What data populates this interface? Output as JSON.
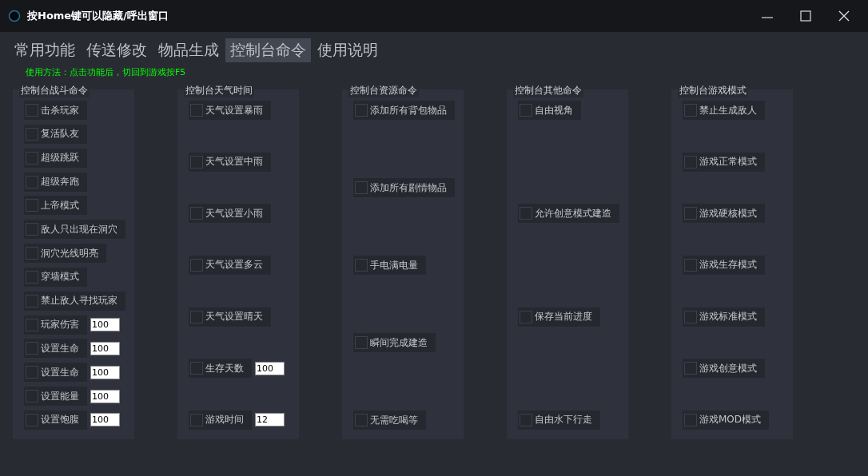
{
  "window": {
    "title": "按Home键可以隐藏/呼出窗口"
  },
  "tabs": [
    {
      "label": "常用功能",
      "selected": false
    },
    {
      "label": "传送修改",
      "selected": false
    },
    {
      "label": "物品生成",
      "selected": false
    },
    {
      "label": "控制台命令",
      "selected": true
    },
    {
      "label": "使用说明",
      "selected": false
    }
  ],
  "hint": "使用方法：点击功能后，切回到游戏按F5",
  "groups": [
    {
      "title": "控制台战斗命令",
      "items": [
        {
          "kind": "toggle",
          "label": "击杀玩家",
          "checked": false
        },
        {
          "kind": "toggle",
          "label": "复活队友",
          "checked": false
        },
        {
          "kind": "toggle",
          "label": "超级跳跃",
          "checked": false
        },
        {
          "kind": "toggle",
          "label": "超级奔跑",
          "checked": false
        },
        {
          "kind": "toggle",
          "label": "上帝模式",
          "checked": false
        },
        {
          "kind": "toggle",
          "label": "敌人只出现在洞穴",
          "checked": false
        },
        {
          "kind": "toggle",
          "label": "洞穴光线明亮",
          "checked": false
        },
        {
          "kind": "toggle",
          "label": "穿墙模式",
          "checked": false
        },
        {
          "kind": "toggle",
          "label": "禁止敌人寻找玩家",
          "checked": false
        },
        {
          "kind": "value",
          "label": "玩家伤害",
          "checked": false,
          "value": "100"
        },
        {
          "kind": "value",
          "label": "设置生命",
          "checked": false,
          "value": "100"
        },
        {
          "kind": "value",
          "label": "设置生命",
          "checked": false,
          "value": "100"
        },
        {
          "kind": "value",
          "label": "设置能量",
          "checked": false,
          "value": "100"
        },
        {
          "kind": "value",
          "label": "设置饱腹",
          "checked": false,
          "value": "100"
        }
      ]
    },
    {
      "title": "控制台天气时间",
      "items": [
        {
          "kind": "toggle",
          "label": "天气设置暴雨",
          "checked": false
        },
        {
          "kind": "toggle",
          "label": "天气设置中雨",
          "checked": false
        },
        {
          "kind": "toggle",
          "label": "天气设置小雨",
          "checked": false
        },
        {
          "kind": "toggle",
          "label": "天气设置多云",
          "checked": false
        },
        {
          "kind": "toggle",
          "label": "天气设置晴天",
          "checked": false
        },
        {
          "kind": "value",
          "label": "生存天数",
          "checked": false,
          "value": "100"
        },
        {
          "kind": "value",
          "label": "游戏时间",
          "checked": false,
          "value": "12"
        }
      ]
    },
    {
      "title": "控制台资源命令",
      "items": [
        {
          "kind": "toggle",
          "label": "添加所有背包物品",
          "checked": false
        },
        {
          "kind": "toggle",
          "label": "添加所有剧情物品",
          "checked": false
        },
        {
          "kind": "toggle",
          "label": "手电满电量",
          "checked": false
        },
        {
          "kind": "toggle",
          "label": "瞬间完成建造",
          "checked": false
        },
        {
          "kind": "toggle",
          "label": "无需吃喝等",
          "checked": false
        }
      ]
    },
    {
      "title": "控制台其他命令",
      "items": [
        {
          "kind": "toggle",
          "label": "自由视角",
          "checked": false
        },
        {
          "kind": "toggle",
          "label": "允许创意模式建造",
          "checked": false
        },
        {
          "kind": "toggle",
          "label": "保存当前进度",
          "checked": false
        },
        {
          "kind": "toggle",
          "label": "自由水下行走",
          "checked": false
        }
      ]
    },
    {
      "title": "控制台游戏模式",
      "items": [
        {
          "kind": "toggle",
          "label": "禁止生成敌人",
          "checked": false
        },
        {
          "kind": "toggle",
          "label": "游戏正常模式",
          "checked": false
        },
        {
          "kind": "toggle",
          "label": "游戏硬核模式",
          "checked": false
        },
        {
          "kind": "toggle",
          "label": "游戏生存模式",
          "checked": false
        },
        {
          "kind": "toggle",
          "label": "游戏标准模式",
          "checked": false
        },
        {
          "kind": "toggle",
          "label": "游戏创意模式",
          "checked": false
        },
        {
          "kind": "toggle",
          "label": "游戏MOD模式",
          "checked": false
        }
      ]
    }
  ]
}
